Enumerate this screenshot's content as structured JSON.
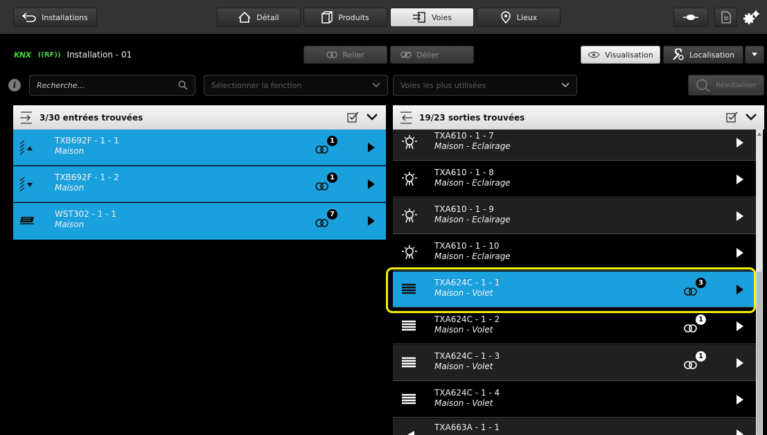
{
  "topbar": {
    "back_label": "Installations",
    "tabs": [
      {
        "label": "Détail",
        "icon": "home-icon",
        "active": false
      },
      {
        "label": "Produits",
        "icon": "box-icon",
        "active": false
      },
      {
        "label": "Voies",
        "icon": "channel-icon",
        "active": true
      },
      {
        "label": "Lieux",
        "icon": "location-pin-icon",
        "active": false
      }
    ]
  },
  "installation": {
    "knx_logo": "KNX",
    "rf_logo": "((RF))",
    "title": "Installation - 01"
  },
  "actions": {
    "link_label": "Relier",
    "unlink_label": "Délier",
    "visualisation_label": "Visualisation",
    "localisation_label": "Localisation"
  },
  "filters": {
    "search_placeholder": "Recherche...",
    "function_placeholder": "Sélectionner la fonction",
    "most_used_placeholder": "Voies les plus utilisées",
    "reset_label": "Réinitialiser"
  },
  "inputs_panel": {
    "title": "3/30 entrées trouvées",
    "items": [
      {
        "name": "TXB692F - 1 - 1",
        "location": "Maison",
        "links": "1",
        "icon": "blinds-up-icon"
      },
      {
        "name": "TXB692F - 1 - 2",
        "location": "Maison",
        "links": "1",
        "icon": "blinds-down-icon"
      },
      {
        "name": "WST302 - 1 - 1",
        "location": "Maison",
        "links": "7",
        "icon": "weather-sensor-icon"
      }
    ]
  },
  "outputs_panel": {
    "title": "19/23 sorties trouvées",
    "items": [
      {
        "name": "TXA610 - 1 - 7",
        "location": "Maison - Eclairage",
        "links": "",
        "icon": "light-icon"
      },
      {
        "name": "TXA610 - 1 - 8",
        "location": "Maison - Eclairage",
        "links": "",
        "icon": "light-icon"
      },
      {
        "name": "TXA610 - 1 - 9",
        "location": "Maison - Eclairage",
        "links": "",
        "icon": "light-icon"
      },
      {
        "name": "TXA610 - 1 - 10",
        "location": "Maison - Eclairage",
        "links": "",
        "icon": "light-icon"
      },
      {
        "name": "TXA624C - 1 - 1",
        "location": "Maison - Volet",
        "links": "3",
        "icon": "shutter-icon",
        "selected": true
      },
      {
        "name": "TXA624C - 1 - 2",
        "location": "Maison - Volet",
        "links": "1",
        "icon": "shutter-icon"
      },
      {
        "name": "TXA624C - 1 - 3",
        "location": "Maison - Volet",
        "links": "1",
        "icon": "shutter-icon"
      },
      {
        "name": "TXA624C - 1 - 4",
        "location": "Maison - Volet",
        "links": "",
        "icon": "shutter-icon"
      },
      {
        "name": "TXA663A - 1 - 1",
        "location": "",
        "links": "",
        "icon": "dimmer-icon"
      }
    ]
  },
  "colors": {
    "selected_row": "#1aa0dc",
    "highlight_outline": "#f2f200",
    "knx_green": "#44d63a"
  }
}
